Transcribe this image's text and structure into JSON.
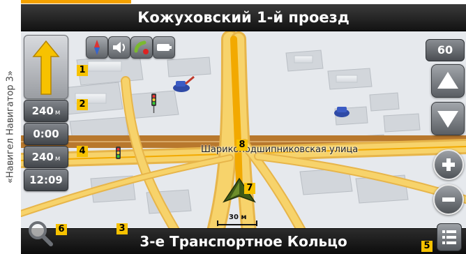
{
  "caption": "«Навигел Навигатор 3»",
  "street": {
    "current": "Кожуховский 1-й проезд",
    "next": "3-е Транспортное Кольцо"
  },
  "info": {
    "turn_distance_value": "240",
    "turn_distance_unit": "м",
    "time_remaining": "0:00",
    "remaining_distance_value": "240",
    "remaining_distance_unit": "м",
    "clock": "12:09"
  },
  "speed": "60",
  "map": {
    "road_label": "Шарикоподшипниковская улица",
    "scale_label": "30 м"
  },
  "markers": [
    "1",
    "2",
    "3",
    "4",
    "5",
    "6",
    "7",
    "8"
  ],
  "status_icons": [
    "compass-icon",
    "speaker-icon",
    "gps-satellite-icon",
    "battery-icon"
  ],
  "colors": {
    "accent": "#f7c200",
    "top_accent": "#f5a200",
    "route": "#f2a900",
    "road_yellow": "#f7d36b",
    "position_arrow": "#3f5a16",
    "bar_dark": "#1a1a1a"
  }
}
